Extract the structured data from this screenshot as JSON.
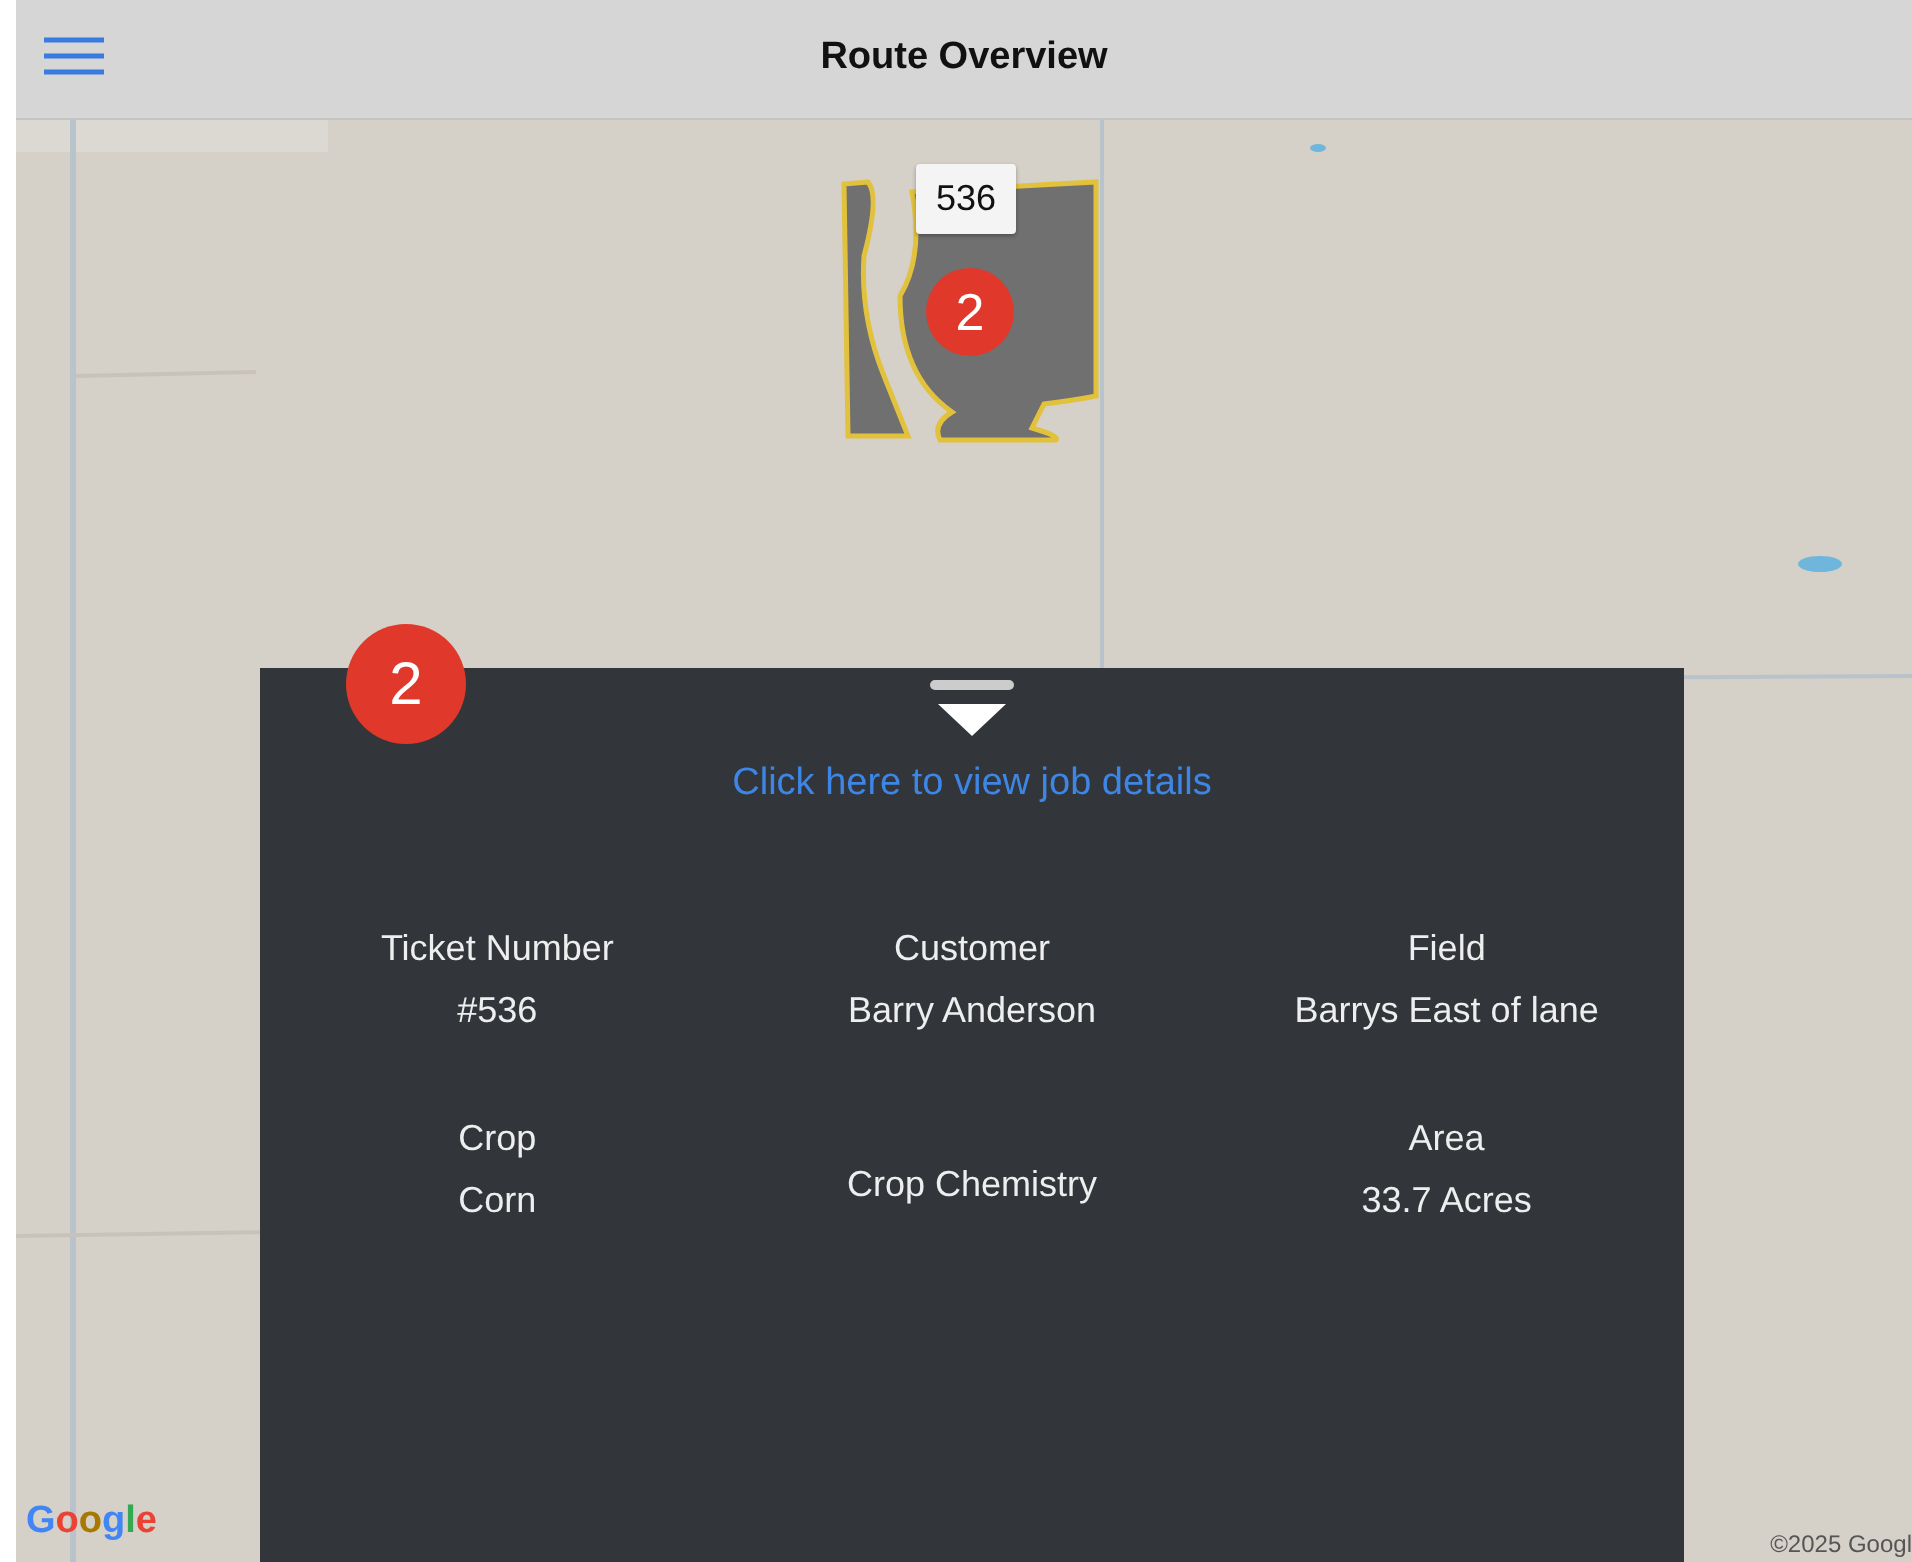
{
  "header": {
    "title": "Route Overview"
  },
  "map": {
    "field_label": "536",
    "field_marker": "2",
    "attribution": "©2025 Googl",
    "logo": "Google"
  },
  "panel": {
    "marker": "2",
    "link": "Click here to view job details",
    "details": [
      {
        "label": "Ticket Number",
        "value": "#536"
      },
      {
        "label": "Customer",
        "value": "Barry Anderson"
      },
      {
        "label": "Field",
        "value": "Barrys East of lane"
      },
      {
        "label": "Crop",
        "value": "Corn"
      },
      {
        "label": "Crop Chemistry"
      },
      {
        "label": "Area",
        "value": "33.7 Acres"
      }
    ]
  }
}
